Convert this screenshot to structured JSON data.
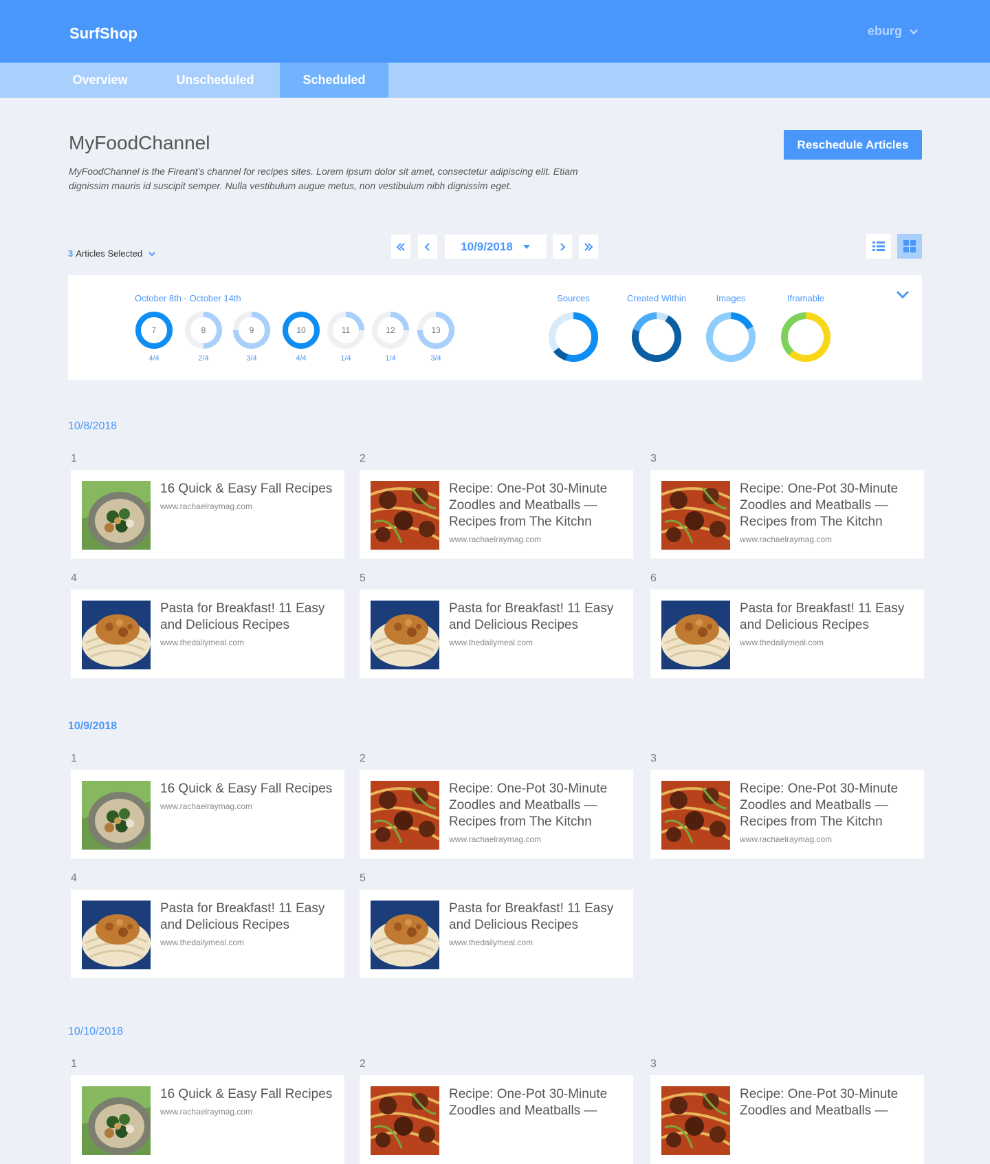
{
  "header": {
    "brand": "SurfShop",
    "user": "eburg"
  },
  "tabs": [
    {
      "label": "Overview",
      "active": false
    },
    {
      "label": "Unscheduled",
      "active": false
    },
    {
      "label": "Scheduled",
      "active": true
    }
  ],
  "channel": {
    "title": "MyFoodChannel",
    "description": "MyFoodChannel is the Fireant’s channel for recipes sites. Lorem ipsum dolor sit amet, consectetur adipiscing elit. Etiam dignissim mauris id suscipit semper. Nulla vestibulum augue metus, non vestibulum nibh dignissim eget."
  },
  "actions": {
    "reschedule": "Reschedule Articles"
  },
  "selection": {
    "count": "3",
    "label": "Articles Selected"
  },
  "pager": {
    "date": "10/9/2018"
  },
  "stats": {
    "week_label": "October 8th - October 14th",
    "days": [
      {
        "day": "7",
        "count": "4/4",
        "filled": 4
      },
      {
        "day": "8",
        "count": "2/4",
        "filled": 2
      },
      {
        "day": "9",
        "count": "3/4",
        "filled": 3
      },
      {
        "day": "10",
        "count": "4/4",
        "filled": 4
      },
      {
        "day": "11",
        "count": "1/4",
        "filled": 1
      },
      {
        "day": "12",
        "count": "1/4",
        "filled": 1
      },
      {
        "day": "13",
        "count": "3/4",
        "filled": 3
      }
    ],
    "metrics": [
      {
        "label": "Sources",
        "segments": [
          {
            "value": 0.55,
            "color": "#0e8df3"
          },
          {
            "value": 0.1,
            "color": "#0a5da3"
          },
          {
            "value": 0.35,
            "color": "#d6ecfd"
          }
        ]
      },
      {
        "label": "Created Within",
        "segments": [
          {
            "value": 0.08,
            "color": "#c6e3fd"
          },
          {
            "value": 0.72,
            "color": "#0c5ea3"
          },
          {
            "value": 0.2,
            "color": "#4aaaf7"
          }
        ]
      },
      {
        "label": "Images",
        "segments": [
          {
            "value": 0.18,
            "color": "#0e8df3"
          },
          {
            "value": 0.82,
            "color": "#8ecdfb"
          }
        ]
      },
      {
        "label": "Iframable",
        "segments": [
          {
            "value": 0.62,
            "color": "#f7d716"
          },
          {
            "value": 0.38,
            "color": "#7ed15a"
          }
        ]
      }
    ],
    "full_color": "#0e8df3",
    "partial_color": "#a9cffd",
    "empty_color": "#eef0f3"
  },
  "groups": [
    {
      "date": "10/8/2018",
      "slots": [
        {
          "num": "1",
          "title": "16 Quick & Easy Fall Recipes",
          "source": "www.rachaelraymag.com",
          "image": "greens-pasta"
        },
        {
          "num": "2",
          "title": "Recipe: One-Pot 30-Minute Zoodles and Meatballs — Recipes from The Kitchn",
          "source": "www.rachaelraymag.com",
          "image": "meatballs"
        },
        {
          "num": "3",
          "title": "Recipe: One-Pot 30-Minute Zoodles and Meatballs — Recipes from The Kitchn",
          "source": "www.rachaelraymag.com",
          "image": "meatballs"
        },
        {
          "num": "4",
          "title": "Pasta for Breakfast! 11 Easy and Delicious Recipes",
          "source": "www.thedailymeal.com",
          "image": "spaghetti"
        },
        {
          "num": "5",
          "title": "Pasta for Breakfast! 11 Easy and Delicious Recipes",
          "source": "www.thedailymeal.com",
          "image": "spaghetti"
        },
        {
          "num": "6",
          "title": "Pasta for Breakfast! 11 Easy and Delicious Recipes",
          "source": "www.thedailymeal.com",
          "image": "spaghetti"
        }
      ]
    },
    {
      "date": "10/9/2018",
      "slots": [
        {
          "num": "1",
          "title": "16 Quick & Easy Fall Recipes",
          "source": "www.rachaelraymag.com",
          "image": "greens-pasta"
        },
        {
          "num": "2",
          "title": "Recipe: One-Pot 30-Minute Zoodles and Meatballs — Recipes from The Kitchn",
          "source": "www.rachaelraymag.com",
          "image": "meatballs"
        },
        {
          "num": "3",
          "title": "Recipe: One-Pot 30-Minute Zoodles and Meatballs — Recipes from The Kitchn",
          "source": "www.rachaelraymag.com",
          "image": "meatballs"
        },
        {
          "num": "4",
          "title": "Pasta for Breakfast! 11 Easy and Delicious Recipes",
          "source": "www.thedailymeal.com",
          "image": "spaghetti"
        },
        {
          "num": "5",
          "title": "Pasta for Breakfast! 11 Easy and Delicious Recipes",
          "source": "www.thedailymeal.com",
          "image": "spaghetti"
        }
      ]
    },
    {
      "date": "10/10/2018",
      "slots": [
        {
          "num": "1",
          "title": "16 Quick & Easy Fall Recipes",
          "source": "www.rachaelraymag.com",
          "image": "greens-pasta"
        },
        {
          "num": "2",
          "title": "Recipe: One-Pot 30-Minute Zoodles and Meatballs —",
          "source": "",
          "image": "meatballs"
        },
        {
          "num": "3",
          "title": "Recipe: One-Pot 30-Minute Zoodles and Meatballs —",
          "source": "",
          "image": "meatballs"
        }
      ]
    }
  ]
}
